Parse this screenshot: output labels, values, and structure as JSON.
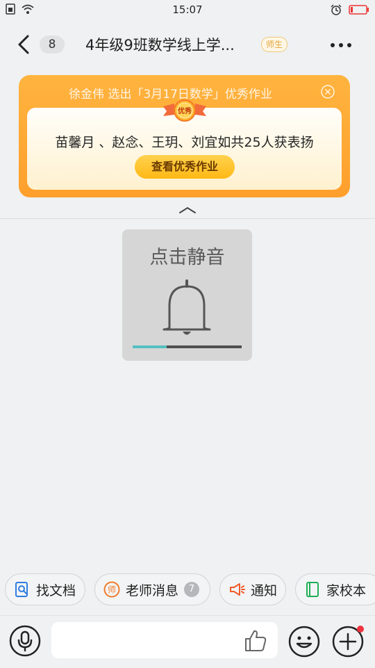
{
  "status_bar": {
    "time": "15:07"
  },
  "header": {
    "unread_count": "8",
    "title": "4年级9班数学线上学...",
    "role_tag": "师生"
  },
  "banner": {
    "header_text": "徐金伟 选出「3月17日数学」优秀作业",
    "award_badge": "优秀",
    "award_text": "苗馨月 、赵念、王玥、刘宜如共25人获表扬",
    "button_label": "查看优秀作业"
  },
  "mute_toast": {
    "title": "点击静音",
    "volume_level": 0.31
  },
  "quick_actions": [
    {
      "label": "找文档",
      "icon": "doc-search-icon"
    },
    {
      "label": "老师消息",
      "icon": "teacher-icon",
      "count": "7"
    },
    {
      "label": "通知",
      "icon": "megaphone-icon"
    },
    {
      "label": "家校本",
      "icon": "notebook-icon"
    }
  ],
  "colors": {
    "banner_orange": "#ffa833",
    "accent_teal": "#54c0c0",
    "notification_red": "#f0343f"
  }
}
